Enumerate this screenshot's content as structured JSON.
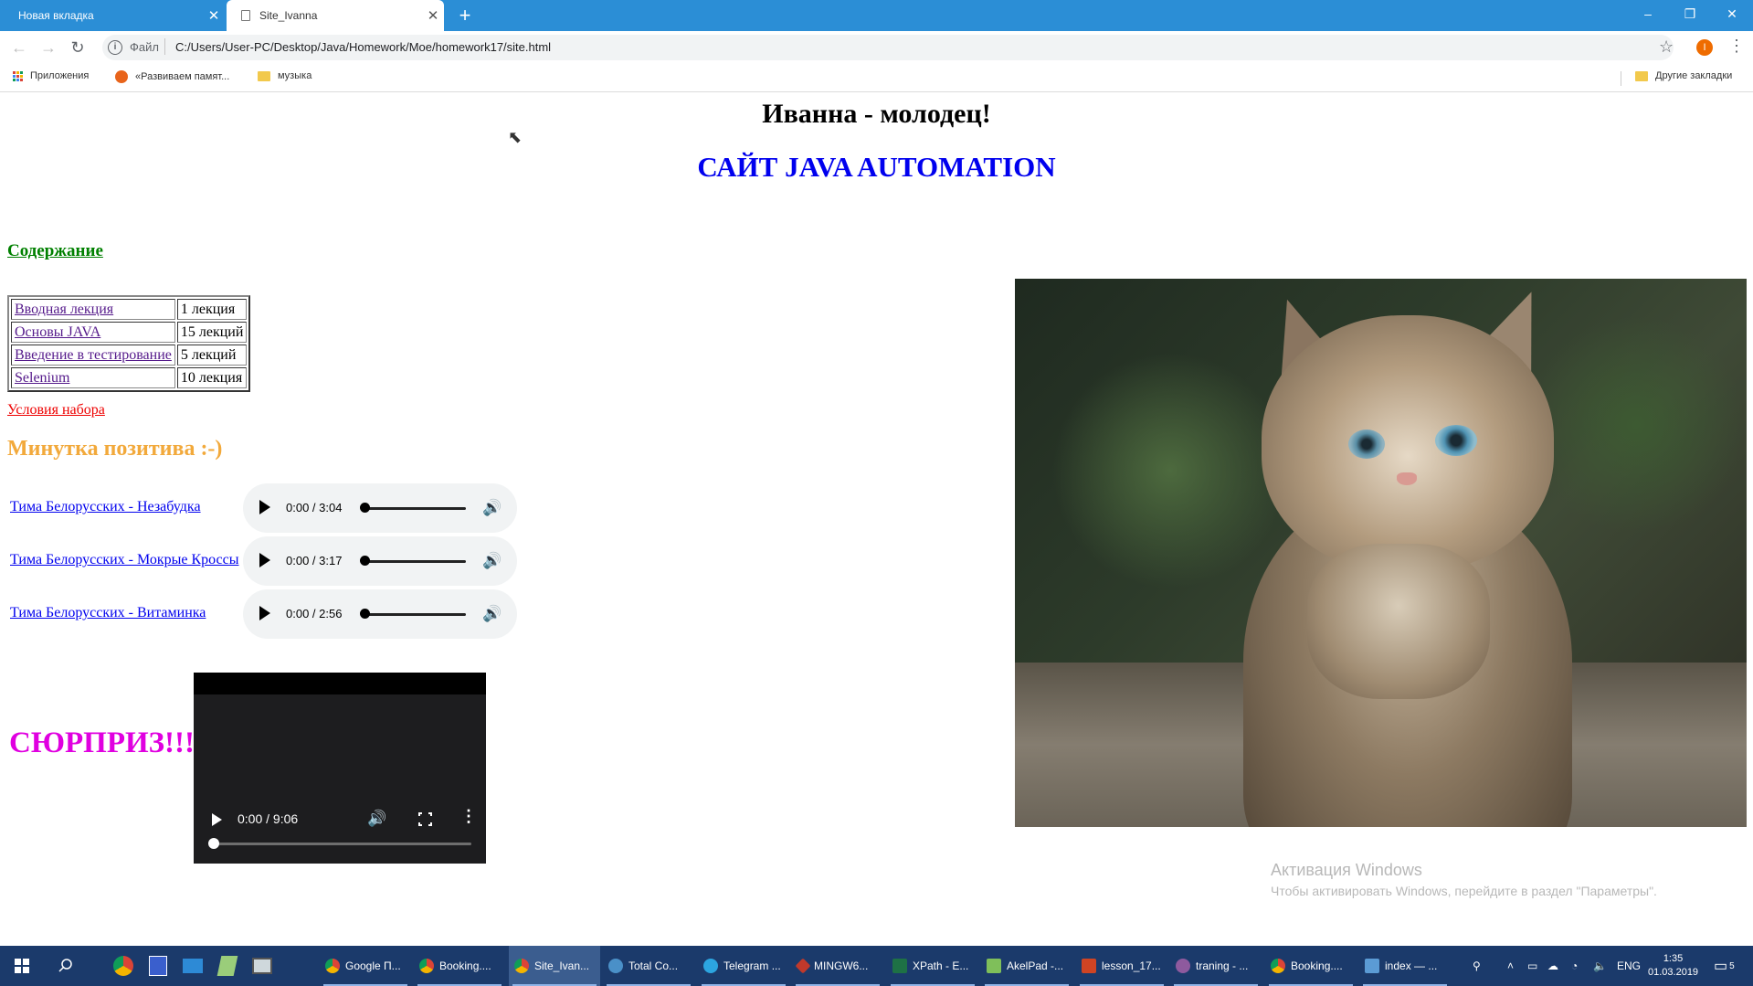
{
  "browser": {
    "tabs": [
      {
        "title": "Новая вкладка",
        "active": false
      },
      {
        "title": "Site_Ivanna",
        "active": true
      }
    ],
    "new_tab_label": "+",
    "window_controls": {
      "minimize": "–",
      "restore": "❐",
      "close": "✕"
    },
    "address": {
      "scheme_label": "Файл",
      "url": "C:/Users/User-PC/Desktop/Java/Homework/Moe/homework17/site.html"
    },
    "profile_initial": "I",
    "bookmarks": [
      {
        "label": "Приложения",
        "icon": "apps-grid-icon"
      },
      {
        "label": "«Развиваем памят...",
        "icon": "site-favicon-icon"
      },
      {
        "label": "музыка",
        "icon": "folder-icon"
      }
    ],
    "other_bookmarks": "Другие закладки"
  },
  "page": {
    "title_line": "Иванна - молодец!",
    "site_heading": "САЙТ JAVA AUTOMATION",
    "contents_link": "Содержание",
    "lectures": [
      {
        "course": "Вводная лекция",
        "count": "1 лекция"
      },
      {
        "course": "Основы JAVA",
        "count": "15 лекций"
      },
      {
        "course": "Введение в тестирование",
        "count": "5 лекций"
      },
      {
        "course": "Selenium",
        "count": "10 лекция"
      }
    ],
    "conditions_link": "Условия набора",
    "positive_heading": "Минутка позитива :-)",
    "songs": [
      {
        "title": "Тима Белорусских - Незабудка",
        "time": "0:00 / 3:04"
      },
      {
        "title": "Тима Белорусских - Мокрые Кроссы",
        "time": "0:00 / 3:17"
      },
      {
        "title": "Тима Белорусских - Витаминка",
        "time": "0:00 / 2:56"
      }
    ],
    "surprise": "СЮРПРИЗ!!!",
    "video_time": "0:00 / 9:06"
  },
  "watermark": {
    "line1": "Активация Windows",
    "line2": "Чтобы активировать Windows, перейдите в раздел \"Параметры\"."
  },
  "taskbar": {
    "items": [
      {
        "label": "Google П...",
        "icon": "chrome-icon",
        "active": false
      },
      {
        "label": "Booking....",
        "icon": "chrome-icon",
        "active": false
      },
      {
        "label": "Site_Ivan...",
        "icon": "chrome-icon",
        "active": true
      },
      {
        "label": "Total Co...",
        "icon": "total-commander-icon",
        "active": false
      },
      {
        "label": "Telegram ...",
        "icon": "telegram-icon",
        "active": false
      },
      {
        "label": "MINGW6...",
        "icon": "git-bash-icon",
        "active": false
      },
      {
        "label": "XPath - E...",
        "icon": "excel-icon",
        "active": false
      },
      {
        "label": "AkelPad -...",
        "icon": "akelpad-icon",
        "active": false
      },
      {
        "label": "lesson_17...",
        "icon": "powerpoint-icon",
        "active": false
      },
      {
        "label": "traning - ...",
        "icon": "intellij-icon",
        "active": false
      },
      {
        "label": "Booking....",
        "icon": "chrome-icon",
        "active": false
      },
      {
        "label": "index — ...",
        "icon": "notepad-icon",
        "active": false
      }
    ],
    "lang": "ENG",
    "time": "1:35",
    "date": "01.03.2019",
    "notification_count": "5"
  }
}
